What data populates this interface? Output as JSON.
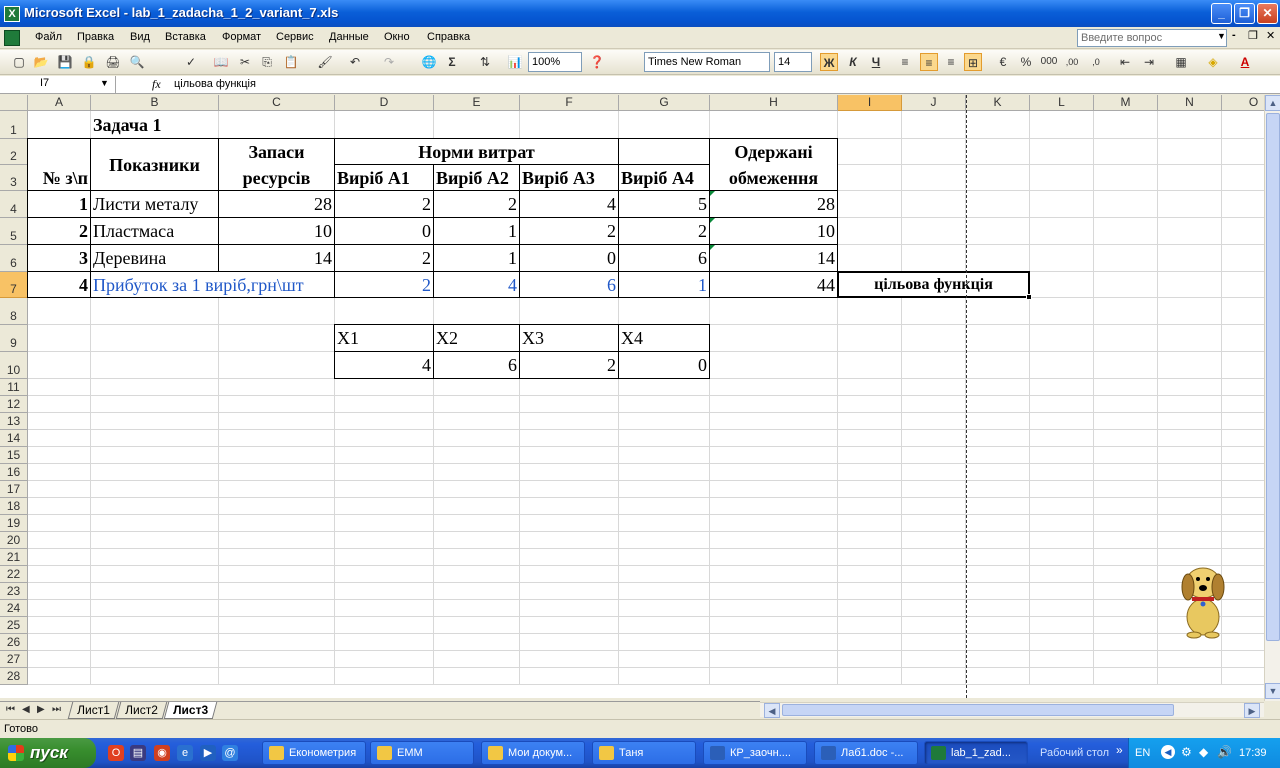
{
  "window": {
    "title": "Microsoft Excel - lab_1_zadacha_1_2_variant_7.xls",
    "app_icon": "X",
    "buttons": {
      "minimize": "_",
      "restore": "❐",
      "close": "✕"
    }
  },
  "menu": {
    "items": [
      "Файл",
      "Правка",
      "Вид",
      "Вставка",
      "Формат",
      "Сервис",
      "Данные",
      "Окно",
      "Справка"
    ],
    "ask_placeholder": "Введите вопрос",
    "doc_buttons": {
      "minimize": "-",
      "restore": "❐",
      "close": "✕"
    }
  },
  "toolbar": {
    "zoom": "100%",
    "font": "Times New Roman",
    "size": "14",
    "bold": "Ж",
    "italic": "К",
    "underline": "Ч",
    "sum": "Σ",
    "percent": "%",
    "thousands": "000",
    "dec_inc": ",00",
    "dec_dec": ",0"
  },
  "formula_bar": {
    "name_box": "I7",
    "fx": "fx",
    "formula": "цільова функція"
  },
  "columns": [
    "A",
    "B",
    "C",
    "D",
    "E",
    "F",
    "G",
    "H",
    "I",
    "J",
    "K",
    "L",
    "M",
    "N",
    "O"
  ],
  "selected_column": "I",
  "rows": [
    "1",
    "2",
    "3",
    "4",
    "5",
    "6",
    "7",
    "8",
    "9",
    "10",
    "11",
    "12",
    "13",
    "14",
    "15",
    "16",
    "17",
    "18",
    "19",
    "20",
    "21",
    "22",
    "23",
    "24",
    "25",
    "26",
    "27",
    "28"
  ],
  "selected_row": "7",
  "sheet": {
    "title": "Задача 1",
    "h_num": "№ з\\п",
    "h_indicators": "Показники",
    "h_reserves_1": "Запаси",
    "h_reserves_2": "ресурсів",
    "h_norms": "Норми витрат",
    "h_obtained_1": "Одержані",
    "h_obtained_2": "обмеження",
    "products": [
      "Виріб А1",
      "Виріб А2",
      "Виріб А3",
      "Виріб А4"
    ],
    "data_rows": [
      {
        "num": "1",
        "name": "Листи металу",
        "reserve": "28",
        "n1": "2",
        "n2": "2",
        "n3": "4",
        "n4": "5",
        "obtained": "28"
      },
      {
        "num": "2",
        "name": "Пластмаса",
        "reserve": "10",
        "n1": "0",
        "n2": "1",
        "n3": "2",
        "n4": "2",
        "obtained": "10"
      },
      {
        "num": "3",
        "name": "Деревина",
        "reserve": "14",
        "n1": "2",
        "n2": "1",
        "n3": "0",
        "n4": "6",
        "obtained": "14"
      }
    ],
    "profit_row": {
      "num": "4",
      "name": "Прибуток за 1  виріб,грн\\шт",
      "p1": "2",
      "p2": "4",
      "p3": "6",
      "p4": "1",
      "value": "44",
      "label": "цільова функція"
    },
    "x_headers": [
      "X1",
      "X2",
      "X3",
      "X4"
    ],
    "x_values": [
      "4",
      "6",
      "2",
      "0"
    ]
  },
  "sheet_tabs": [
    "Лист1",
    "Лист2",
    "Лист3"
  ],
  "active_tab": "Лист3",
  "status": "Готово",
  "taskbar": {
    "start": "пуск",
    "tasks": [
      "Економетрия",
      "ЕММ",
      "Мои докум...",
      "Таня",
      "КР_заочн....",
      "Лаб1.doc -...",
      "lab_1_zad..."
    ],
    "active_task": "lab_1_zad...",
    "desktop": "Рабочий стол",
    "desktop_arrows": "»",
    "lang": "EN",
    "time": "17:39"
  },
  "colors": {
    "selection_header": "#f8c265",
    "profit_text": "#2058c8",
    "taskbar": "#245edc",
    "start": "#388e2e"
  }
}
